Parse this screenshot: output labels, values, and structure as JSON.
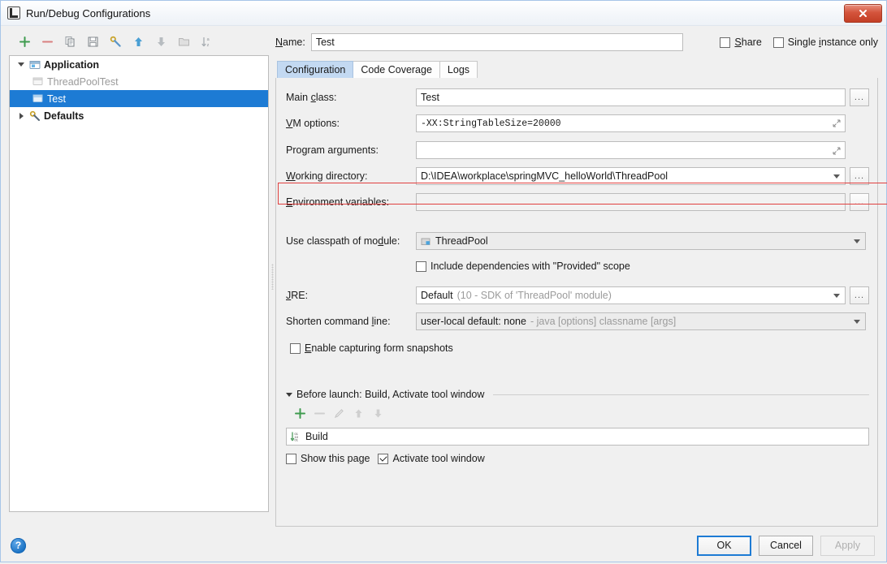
{
  "window": {
    "title": "Run/Debug Configurations",
    "icon": "intellij-idea-icon",
    "close_label": "✕"
  },
  "toolbar": {
    "items": [
      {
        "name": "add-configuration-button",
        "icon": "plus-icon",
        "label": "+"
      },
      {
        "name": "remove-configuration-button",
        "icon": "minus-icon",
        "label": "−"
      },
      {
        "name": "copy-configuration-button",
        "icon": "copy-icon",
        "label": ""
      },
      {
        "name": "save-configuration-button",
        "icon": "save-icon",
        "label": ""
      },
      {
        "name": "edit-defaults-button",
        "icon": "wrench-icon",
        "label": ""
      },
      {
        "name": "move-up-button",
        "icon": "arrow-up-icon",
        "label": ""
      },
      {
        "name": "move-down-button",
        "icon": "arrow-down-icon",
        "label": ""
      },
      {
        "name": "create-folder-button",
        "icon": "folder-icon",
        "label": ""
      },
      {
        "name": "sort-configurations-button",
        "icon": "sort-az-icon",
        "label": ""
      }
    ]
  },
  "tree": {
    "nodes": [
      {
        "label": "Application",
        "icon": "application-icon",
        "state": "expanded",
        "level": 0,
        "style": "bold"
      },
      {
        "label": "ThreadPoolTest",
        "icon": "java-class-icon",
        "state": "leaf",
        "level": 1,
        "style": "dim"
      },
      {
        "label": "Test",
        "icon": "java-class-icon",
        "state": "leaf",
        "level": 1,
        "style": "selected"
      },
      {
        "label": "Defaults",
        "icon": "wrench-icon",
        "state": "collapsed",
        "level": 0,
        "style": "bold"
      }
    ]
  },
  "header": {
    "name_label": "Name:",
    "name_value": "Test",
    "share_label": "Share",
    "share_checked": false,
    "single_instance_label": "Single instance only",
    "single_instance_checked": false
  },
  "tabs": [
    {
      "label": "Configuration",
      "active": true
    },
    {
      "label": "Code Coverage",
      "active": false
    },
    {
      "label": "Logs",
      "active": false
    }
  ],
  "form": {
    "main_class_label": "Main class:",
    "main_class_value": "Test",
    "vm_options_label": "VM options:",
    "vm_options_value": "-XX:StringTableSize=20000",
    "program_arguments_label": "Program arguments:",
    "program_arguments_value": "",
    "working_directory_label": "Working directory:",
    "working_directory_value": "D:\\IDEA\\workplace\\springMVC_helloWorld\\ThreadPool",
    "environment_variables_label": "Environment variables:",
    "environment_variables_value": "",
    "classpath_module_label": "Use classpath of module:",
    "classpath_module_value": "ThreadPool",
    "include_provided_label": "Include dependencies with \"Provided\" scope",
    "include_provided_checked": false,
    "jre_label": "JRE:",
    "jre_value": "Default",
    "jre_hint": "(10 - SDK of 'ThreadPool' module)",
    "shorten_command_label": "Shorten command line:",
    "shorten_command_value": "user-local default: none",
    "shorten_command_hint": "- java [options] classname [args]",
    "form_snapshots_label": "Enable capturing form snapshots",
    "form_snapshots_checked": false,
    "browse_label": "..."
  },
  "before_launch": {
    "title": "Before launch: Build, Activate tool window",
    "toolbar": [
      {
        "name": "add-task-button",
        "icon": "plus-icon",
        "enabled": true
      },
      {
        "name": "remove-task-button",
        "icon": "minus-icon",
        "enabled": false
      },
      {
        "name": "edit-task-button",
        "icon": "pencil-icon",
        "enabled": false
      },
      {
        "name": "task-move-up-button",
        "icon": "arrow-up-icon",
        "enabled": false
      },
      {
        "name": "task-move-down-button",
        "icon": "arrow-down-icon",
        "enabled": false
      }
    ],
    "tasks": [
      {
        "label": "Build",
        "icon": "build-icon"
      }
    ],
    "show_page_label": "Show this page",
    "show_page_checked": false,
    "activate_tool_window_label": "Activate tool window",
    "activate_tool_window_checked": true
  },
  "footer": {
    "help_label": "?",
    "ok_label": "OK",
    "cancel_label": "Cancel",
    "apply_label": "Apply",
    "apply_enabled": false
  },
  "colors": {
    "selection": "#1d7bd4",
    "highlight_border": "#e0403f",
    "tab_active": "#c3d9f2",
    "accent_green": "#3f9b4f"
  }
}
